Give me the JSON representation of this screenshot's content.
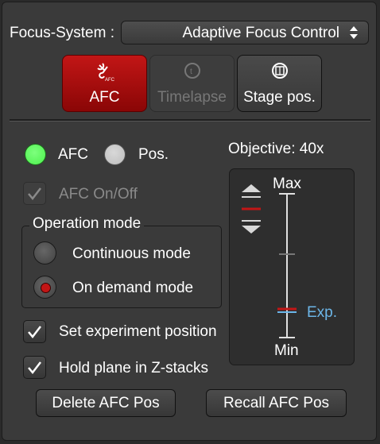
{
  "focus_system": {
    "label": "Focus-System :",
    "selected": "Adaptive Focus Control"
  },
  "tabs": [
    {
      "label": "AFC",
      "icon": "wrench-afc-icon",
      "state": "active"
    },
    {
      "label": "Timelapse",
      "icon": "timelapse-icon",
      "state": "disabled"
    },
    {
      "label": "Stage pos.",
      "icon": "stage-position-icon",
      "state": "normal"
    }
  ],
  "indicators": {
    "afc_label": "AFC",
    "afc_color": "#4cf04c",
    "pos_label": "Pos.",
    "pos_color": "#bdbdbd"
  },
  "objective": "Objective: 40x",
  "afc_onoff": {
    "label": "AFC On/Off",
    "checked": true,
    "disabled": true
  },
  "operation_mode": {
    "title": "Operation mode",
    "options": [
      "Continuous mode",
      "On demand mode"
    ],
    "selected": "On demand mode"
  },
  "checkboxes": {
    "set_experiment": {
      "label": "Set experiment position",
      "checked": true
    },
    "hold_plane": {
      "label": "Hold plane in Z-stacks",
      "checked": true
    }
  },
  "z_slider": {
    "max_label": "Max",
    "min_label": "Min",
    "exp_label": "Exp.",
    "exp_color": "#6cb6e8"
  },
  "buttons": {
    "delete": "Delete AFC Pos",
    "recall": "Recall AFC Pos"
  },
  "colors": {
    "accent_red": "#b01010",
    "afc_green": "#4cf04c",
    "exp_blue": "#6cb6e8"
  }
}
